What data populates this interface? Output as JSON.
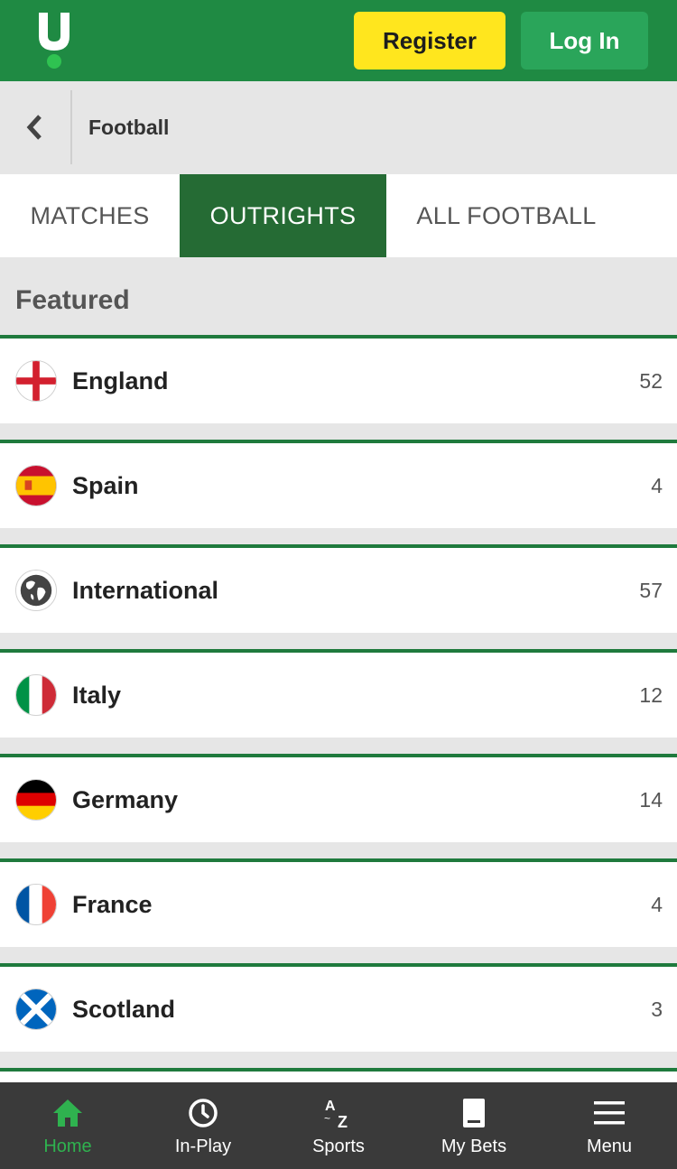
{
  "header": {
    "register_label": "Register",
    "login_label": "Log In",
    "brand_color": "#1f8a43",
    "register_color": "#ffe61e"
  },
  "breadcrumb": {
    "title": "Football"
  },
  "tabs": [
    {
      "label": "MATCHES",
      "active": false
    },
    {
      "label": "OUTRIGHTS",
      "active": true
    },
    {
      "label": "ALL FOOTBALL",
      "active": false
    }
  ],
  "featured": {
    "heading": "Featured",
    "items": [
      {
        "label": "England",
        "count": "52",
        "icon": "england-flag-icon"
      },
      {
        "label": "Spain",
        "count": "4",
        "icon": "spain-flag-icon"
      },
      {
        "label": "International",
        "count": "57",
        "icon": "globe-icon"
      },
      {
        "label": "Italy",
        "count": "12",
        "icon": "italy-flag-icon"
      },
      {
        "label": "Germany",
        "count": "14",
        "icon": "germany-flag-icon"
      },
      {
        "label": "France",
        "count": "4",
        "icon": "france-flag-icon"
      },
      {
        "label": "Scotland",
        "count": "3",
        "icon": "scotland-flag-icon"
      }
    ]
  },
  "bottom_nav": [
    {
      "label": "Home",
      "icon": "home-icon",
      "active": true
    },
    {
      "label": "In-Play",
      "icon": "clock-icon",
      "active": false
    },
    {
      "label": "Sports",
      "icon": "az-icon",
      "active": false
    },
    {
      "label": "My Bets",
      "icon": "betslip-icon",
      "active": false
    },
    {
      "label": "Menu",
      "icon": "hamburger-icon",
      "active": false
    }
  ]
}
